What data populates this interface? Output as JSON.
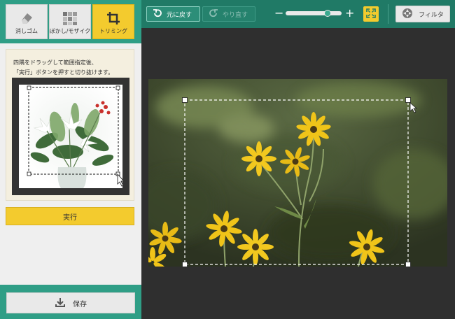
{
  "tools": [
    {
      "label": "消しゴム",
      "icon": "eraser-icon"
    },
    {
      "label": "ぼかし/モザイク",
      "icon": "mosaic-icon"
    },
    {
      "label": "トリミング",
      "icon": "crop-icon",
      "active": true
    }
  ],
  "help": {
    "line1": "四隅をドラッグして範囲指定後、",
    "line2": "「実行」ボタンを押すと切り抜けます。"
  },
  "execute_label": "実行",
  "save_label": "保存",
  "toolbar": {
    "undo_label": "元に戻す",
    "redo_label": "やり直す",
    "zoom_minus": "−",
    "zoom_plus": "+",
    "zoom_level": 0.75,
    "filter_label": "フィルタ"
  },
  "colors": {
    "accent": "#2f9e86",
    "topbar": "#207a66",
    "highlight": "#f3cb2e",
    "canvas": "#2f2f2f"
  }
}
